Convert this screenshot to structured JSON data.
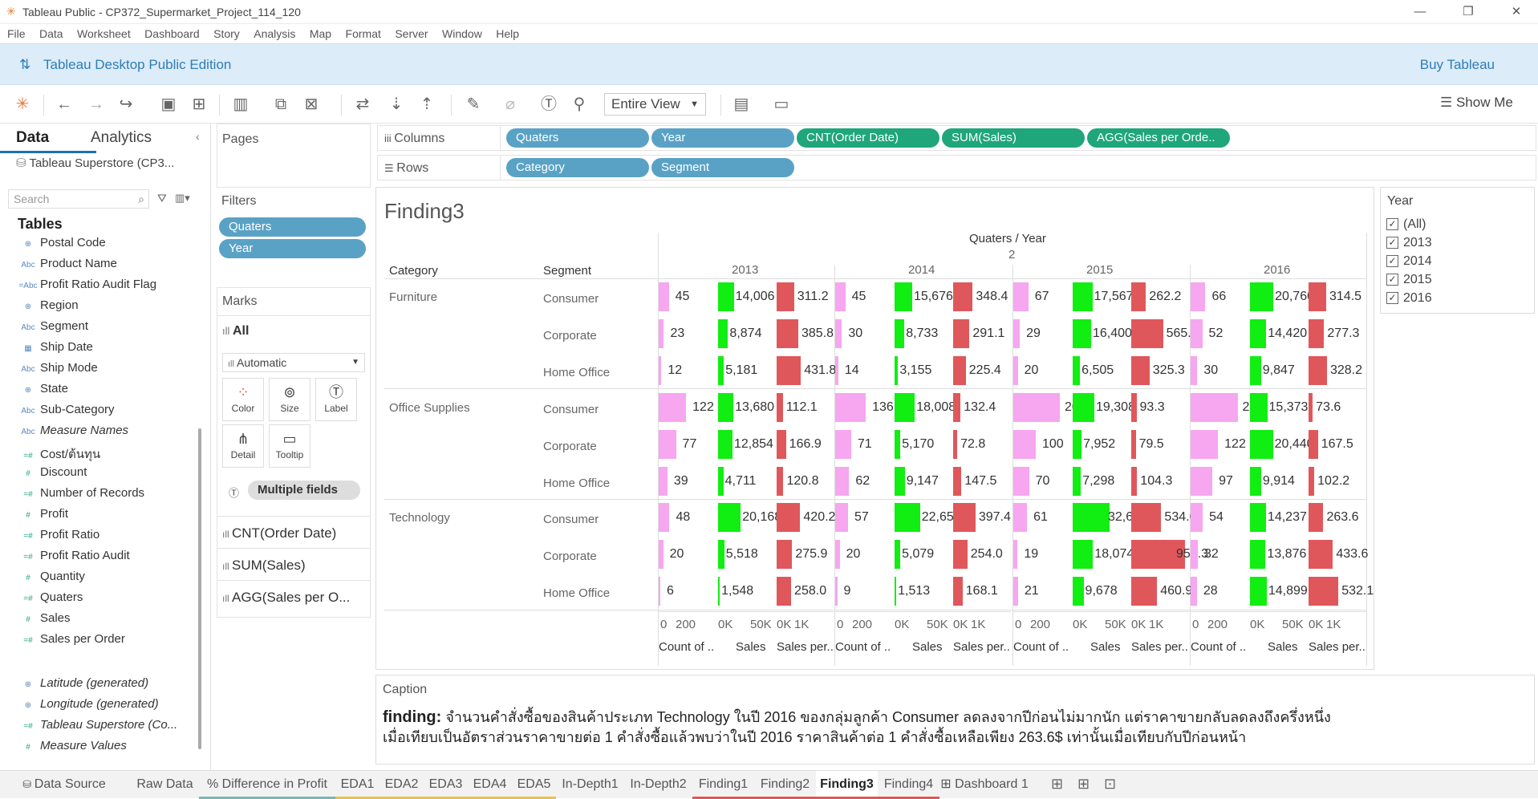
{
  "window": {
    "title": "Tableau Public - CP372_Supermarket_Project_114_120"
  },
  "menu": [
    "File",
    "Data",
    "Worksheet",
    "Dashboard",
    "Story",
    "Analysis",
    "Map",
    "Format",
    "Server",
    "Window",
    "Help"
  ],
  "banner": {
    "edition": "Tableau Desktop Public Edition",
    "buy": "Buy Tableau"
  },
  "toolbar": {
    "view_mode": "Entire View",
    "show_me": "Show Me"
  },
  "left": {
    "tab_data": "Data",
    "tab_analytics": "Analytics",
    "datasource": "Tableau Superstore (CP3...",
    "search_placeholder": "Search",
    "tables_header": "Tables",
    "fields": [
      {
        "icon": "⊕",
        "label": "Postal Code",
        "italic": false
      },
      {
        "icon": "Abc",
        "label": "Product Name",
        "italic": false
      },
      {
        "icon": "=Abc",
        "label": "Profit Ratio Audit Flag",
        "italic": false
      },
      {
        "icon": "⊕",
        "label": "Region",
        "italic": false
      },
      {
        "icon": "Abc",
        "label": "Segment",
        "italic": false
      },
      {
        "icon": "▦",
        "label": "Ship Date",
        "italic": false
      },
      {
        "icon": "Abc",
        "label": "Ship Mode",
        "italic": false
      },
      {
        "icon": "⊕",
        "label": "State",
        "italic": false
      },
      {
        "icon": "Abc",
        "label": "Sub-Category",
        "italic": false
      },
      {
        "icon": "Abc",
        "label": "Measure Names",
        "italic": true
      },
      {
        "icon": "=#",
        "label": "Cost/ต้นทุน",
        "italic": false
      },
      {
        "icon": "#",
        "label": "Discount",
        "italic": false
      },
      {
        "icon": "=#",
        "label": "Number of Records",
        "italic": false
      },
      {
        "icon": "#",
        "label": "Profit",
        "italic": false
      },
      {
        "icon": "=#",
        "label": "Profit Ratio",
        "italic": false
      },
      {
        "icon": "=#",
        "label": "Profit Ratio Audit",
        "italic": false
      },
      {
        "icon": "#",
        "label": "Quantity",
        "italic": false
      },
      {
        "icon": "=#",
        "label": "Quaters",
        "italic": false
      },
      {
        "icon": "#",
        "label": "Sales",
        "italic": false
      },
      {
        "icon": "=#",
        "label": "Sales per Order",
        "italic": false
      },
      {
        "icon": "=#",
        "label": "Year",
        "italic": false
      },
      {
        "icon": "⊕",
        "label": "Latitude (generated)",
        "italic": true
      },
      {
        "icon": "⊕",
        "label": "Longitude (generated)",
        "italic": true
      },
      {
        "icon": "=#",
        "label": "Tableau Superstore (Co...",
        "italic": true
      },
      {
        "icon": "#",
        "label": "Measure Values",
        "italic": true
      }
    ]
  },
  "pages": {
    "header": "Pages"
  },
  "filters": {
    "header": "Filters",
    "items": [
      "Quaters",
      "Year"
    ]
  },
  "marks": {
    "header": "Marks",
    "all": "All",
    "type": "Automatic",
    "color": "Color",
    "size": "Size",
    "label": "Label",
    "detail": "Detail",
    "tooltip": "Tooltip",
    "multiple": "Multiple fields",
    "measures": [
      "CNT(Order Date)",
      "SUM(Sales)",
      "AGG(Sales per O..."
    ]
  },
  "shelves": {
    "columns_label": "Columns",
    "rows_label": "Rows",
    "columns": [
      "Quaters",
      "Year",
      "CNT(Order Date)",
      "SUM(Sales)",
      "AGG(Sales per Orde.."
    ],
    "rows": [
      "Category",
      "Segment"
    ]
  },
  "viz": {
    "title": "Finding3",
    "top_header": "Quaters / Year",
    "quarter": "2",
    "cat_header": "Category",
    "seg_header": "Segment",
    "years": [
      "2013",
      "2014",
      "2015",
      "2016"
    ],
    "axis_ticks": {
      "count": [
        "0",
        "200"
      ],
      "sales": [
        "0K",
        "50K"
      ],
      "spo": [
        "0K",
        "1K"
      ]
    },
    "measure_labels": [
      "Count of ..",
      "Sales",
      "Sales per.."
    ],
    "colors": {
      "count": "#f7a6f0",
      "sales": "#11ee11",
      "spo": "#e0575b"
    }
  },
  "chart_data": {
    "type": "table",
    "title": "Finding3",
    "categories": [
      "Furniture",
      "Office Supplies",
      "Technology"
    ],
    "segments": [
      "Consumer",
      "Corporate",
      "Home Office"
    ],
    "years": [
      "2013",
      "2014",
      "2015",
      "2016"
    ],
    "rows": [
      {
        "category": "Furniture",
        "segment": "Consumer",
        "count": [
          45,
          45,
          67,
          66
        ],
        "sales": [
          "14,006",
          "15,676",
          "17,567",
          "20,760"
        ],
        "sales_v": [
          14006,
          15676,
          17567,
          20760
        ],
        "spo": [
          "311.2",
          "348.4",
          "262.2",
          "314.5"
        ]
      },
      {
        "category": "",
        "segment": "Corporate",
        "count": [
          23,
          30,
          29,
          52
        ],
        "sales": [
          "8,874",
          "8,733",
          "16,400",
          "14,420"
        ],
        "sales_v": [
          8874,
          8733,
          16400,
          14420
        ],
        "spo": [
          "385.8",
          "291.1",
          "565.5",
          "277.3"
        ]
      },
      {
        "category": "",
        "segment": "Home Office",
        "count": [
          12,
          14,
          20,
          30
        ],
        "sales": [
          "5,181",
          "3,155",
          "6,505",
          "9,847"
        ],
        "sales_v": [
          5181,
          3155,
          6505,
          9847
        ],
        "spo": [
          "431.8",
          "225.4",
          "325.3",
          "328.2"
        ]
      },
      {
        "category": "Office Supplies",
        "segment": "Consumer",
        "count": [
          122,
          136,
          207,
          209
        ],
        "sales": [
          "13,680",
          "18,008",
          "19,308",
          "15,373"
        ],
        "sales_v": [
          13680,
          18008,
          19308,
          15373
        ],
        "spo": [
          "112.1",
          "132.4",
          "93.3",
          "73.6"
        ]
      },
      {
        "category": "",
        "segment": "Corporate",
        "count": [
          77,
          71,
          100,
          122
        ],
        "sales": [
          "12,854",
          "5,170",
          "7,952",
          "20,440"
        ],
        "sales_v": [
          12854,
          5170,
          7952,
          20440
        ],
        "spo": [
          "166.9",
          "72.8",
          "79.5",
          "167.5"
        ]
      },
      {
        "category": "",
        "segment": "Home Office",
        "count": [
          39,
          62,
          70,
          97
        ],
        "sales": [
          "4,711",
          "9,147",
          "7,298",
          "9,914"
        ],
        "sales_v": [
          4711,
          9147,
          7298,
          9914
        ],
        "spo": [
          "120.8",
          "147.5",
          "104.3",
          "102.2"
        ]
      },
      {
        "category": "Technology",
        "segment": "Consumer",
        "count": [
          48,
          57,
          61,
          54
        ],
        "sales": [
          "20,168",
          "22,654",
          "32,608",
          "14,237"
        ],
        "sales_v": [
          20168,
          22654,
          32608,
          14237
        ],
        "spo": [
          "420.2",
          "397.4",
          "534.6",
          "263.6"
        ]
      },
      {
        "category": "",
        "segment": "Corporate",
        "count": [
          20,
          20,
          19,
          32
        ],
        "sales": [
          "5,518",
          "5,079",
          "18,074",
          "13,876"
        ],
        "sales_v": [
          5518,
          5079,
          18074,
          13876
        ],
        "spo": [
          "275.9",
          "254.0",
          "951.3",
          "433.6"
        ]
      },
      {
        "category": "",
        "segment": "Home Office",
        "count": [
          6,
          9,
          21,
          28
        ],
        "sales": [
          "1,548",
          "1,513",
          "9,678",
          "14,899"
        ],
        "sales_v": [
          1548,
          1513,
          9678,
          14899
        ],
        "spo": [
          "258.0",
          "168.1",
          "460.9",
          "532.1"
        ]
      }
    ]
  },
  "yearfilter": {
    "header": "Year",
    "items": [
      "(All)",
      "2013",
      "2014",
      "2015",
      "2016"
    ]
  },
  "caption": {
    "header": "Caption",
    "bold": "finding:",
    "line1": " จำนวนคำสั่งซื้อของสินค้าประเภท Technology ในปี 2016 ของกลุ่มลูกค้า Consumer ลดลงจากปีก่อนไม่มากนัก แต่ราคาขายกลับลดลงถึงครึ่งหนึ่ง",
    "line2": "เมื่อเทียบเป็นอัตราส่วนราคาขายต่อ 1 คำสั่งซื้อแล้วพบว่าในปี 2016 ราคาสินค้าต่อ 1 คำสั่งซื้อเหลือเพียง 263.6$ เท่านั้นเมื่อเทียบกับปีก่อนหน้า"
  },
  "tabs": {
    "datasource": "Data Source",
    "items": [
      "Raw Data",
      "% Difference in Profit",
      "EDA1",
      "EDA2",
      "EDA3",
      "EDA4",
      "EDA5",
      "In-Depth1",
      "In-Depth2",
      "Finding1",
      "Finding2",
      "Finding3",
      "Finding4",
      "Dashboard 1"
    ]
  }
}
